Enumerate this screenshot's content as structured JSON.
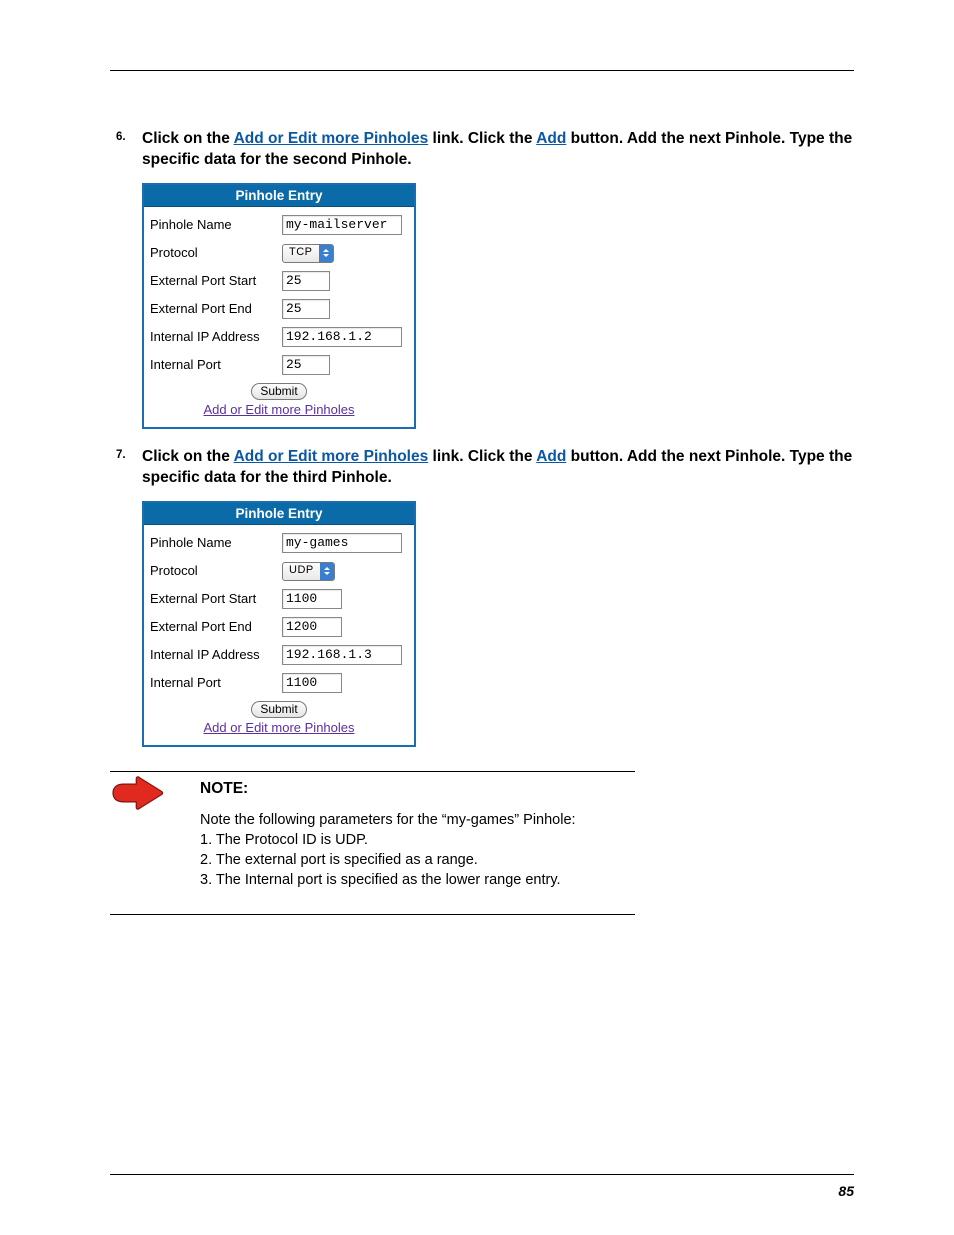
{
  "page_number": "85",
  "steps": [
    {
      "num": "6.",
      "segments": [
        {
          "t": "Click on the "
        },
        {
          "t": "Add or Edit more Pinholes",
          "link": true
        },
        {
          "t": " link. Click the "
        },
        {
          "t": "Add",
          "link": true
        },
        {
          "t": " button. Add the next Pinhole. Type the specific data for the second Pinhole."
        }
      ],
      "form": {
        "header": "Pinhole Entry",
        "rows": [
          {
            "label": "Pinhole Name",
            "type": "text",
            "value": "my-mailserver",
            "w": "wide"
          },
          {
            "label": "Protocol",
            "type": "select",
            "value": "TCP"
          },
          {
            "label": "External Port Start",
            "type": "text",
            "value": "25",
            "w": "med"
          },
          {
            "label": "External Port End",
            "type": "text",
            "value": "25",
            "w": "med"
          },
          {
            "label": "Internal IP Address",
            "type": "text",
            "value": "192.168.1.2",
            "w": "wide"
          },
          {
            "label": "Internal Port",
            "type": "text",
            "value": "25",
            "w": "med"
          }
        ],
        "submit": "Submit",
        "footer_link": "Add or Edit more Pinholes"
      }
    },
    {
      "num": "7.",
      "segments": [
        {
          "t": "Click on the "
        },
        {
          "t": "Add or Edit more Pinholes",
          "link": true
        },
        {
          "t": " link. Click the "
        },
        {
          "t": "Add",
          "link": true
        },
        {
          "t": " button. Add the next Pinhole. Type the specific data for the third Pinhole."
        }
      ],
      "form": {
        "header": "Pinhole Entry",
        "rows": [
          {
            "label": "Pinhole Name",
            "type": "text",
            "value": "my-games",
            "w": "wide"
          },
          {
            "label": "Protocol",
            "type": "select",
            "value": "UDP"
          },
          {
            "label": "External Port Start",
            "type": "text",
            "value": "1100",
            "w": "med2"
          },
          {
            "label": "External Port End",
            "type": "text",
            "value": "1200",
            "w": "med2"
          },
          {
            "label": "Internal IP Address",
            "type": "text",
            "value": "192.168.1.3",
            "w": "wide"
          },
          {
            "label": "Internal Port",
            "type": "text",
            "value": "1100",
            "w": "med2"
          }
        ],
        "submit": "Submit",
        "footer_link": "Add or Edit more Pinholes"
      }
    }
  ],
  "note": {
    "title": "NOTE:",
    "intro": "Note the following parameters for the “my-games” Pinhole:",
    "items": [
      "1. The Protocol ID is UDP.",
      "2. The external port is specified as a range.",
      "3. The Internal port is specified as the lower range entry."
    ]
  }
}
